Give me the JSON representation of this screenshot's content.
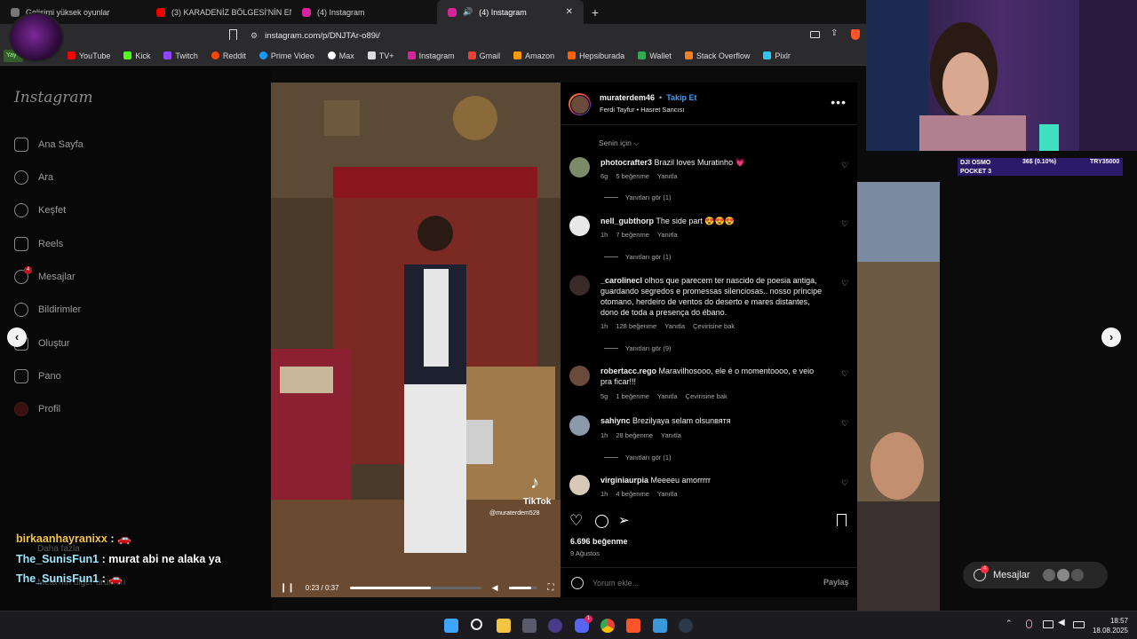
{
  "browser": {
    "tabs": [
      {
        "label": "Gelişimi yüksek oyunlar",
        "color": "#888888"
      },
      {
        "label": "(3) KARADENİZ BÖLGESİ'NİN EN DÜ",
        "color": "#ff0000"
      },
      {
        "label": "(4) Instagram",
        "color": "#d6249f"
      },
      {
        "label": "(4) Instagram",
        "color": "#d6249f"
      }
    ],
    "new_tab": "+",
    "url": "instagram.com/p/DNJTAr-o89i/",
    "bookmarks": [
      {
        "label": "YouTube",
        "color": "#ff0000"
      },
      {
        "label": "Kick",
        "color": "#53fc18"
      },
      {
        "label": "Twitch",
        "color": "#9146ff"
      },
      {
        "label": "Reddit",
        "color": "#ff4500"
      },
      {
        "label": "Prime Video",
        "color": "#1a98ff"
      },
      {
        "label": "Max",
        "color": "#ffffff"
      },
      {
        "label": "TV+",
        "color": "#dddddd"
      },
      {
        "label": "Instagram",
        "color": "#d6249f"
      },
      {
        "label": "Gmail",
        "color": "#ea4335"
      },
      {
        "label": "Amazon",
        "color": "#ff9900"
      },
      {
        "label": "Hepsiburada",
        "color": "#ff6000"
      },
      {
        "label": "Wallet",
        "color": "#34a853"
      },
      {
        "label": "Stack Overflow",
        "color": "#f48024"
      },
      {
        "label": "Pixlr",
        "color": "#2fc6f6"
      }
    ],
    "status_badge": "Yay"
  },
  "sidebar": {
    "logo": "Instagram",
    "items": [
      {
        "label": "Ana Sayfa",
        "icon": "home-icon"
      },
      {
        "label": "Ara",
        "icon": "search-icon"
      },
      {
        "label": "Keşfet",
        "icon": "compass-icon"
      },
      {
        "label": "Reels",
        "icon": "reels-icon"
      },
      {
        "label": "Mesajlar",
        "icon": "messenger-icon"
      },
      {
        "label": "Bildirimler",
        "icon": "heart-icon"
      },
      {
        "label": "Oluştur",
        "icon": "plus-icon"
      },
      {
        "label": "Pano",
        "icon": "dashboard-icon"
      },
      {
        "label": "Profil",
        "icon": "profile-icon"
      }
    ],
    "messages_badge": "4",
    "more": "Daha fazla",
    "meta": "Meta'nın diğer ürünleri"
  },
  "video": {
    "time": "0:23 / 0:37",
    "progress": 0.62,
    "volume": 0.8,
    "watermark": "TikTok",
    "watermark_user": "@muraterdem528"
  },
  "post": {
    "username": "muraterdem46",
    "follow": "Takip Et",
    "song": "Ferdi Tayfur • Hasret Sancısı",
    "sort": "Senin için",
    "comments": [
      {
        "user": "photocrafter3",
        "text": "Brazil loves Muratinho 💗",
        "age": "6g",
        "likes": "5 beğenme",
        "reply": "Yanıtla",
        "replies": "Yanıtları gör (1)"
      },
      {
        "user": "nell_gubthorp",
        "text": "The side part 😍😍😍",
        "age": "1h",
        "likes": "7 beğenme",
        "reply": "Yanıtla",
        "replies": "Yanıtları gör (1)"
      },
      {
        "user": "_carolinecl",
        "text": "olhos que parecem ter nascido de poesia antiga, guardando segredos e promessas silenciosas.. nosso príncipe otomano, herdeiro de ventos do deserto e mares distantes, dono de toda a presença do ébano.",
        "age": "1h",
        "likes": "128 beğenme",
        "reply": "Yanıtla",
        "translate": "Çevirisine bak",
        "replies": "Yanıtları gör (9)"
      },
      {
        "user": "robertacc.rego",
        "text": "Maravilhosooo, ele é o momentoooo, e veio pra ficar!!!",
        "age": "5g",
        "likes": "1 beğenme",
        "reply": "Yanıtla",
        "translate": "Çevirisine bak"
      },
      {
        "user": "sahiync",
        "text": "Brezilyaya selam olsunвятя",
        "age": "1h",
        "likes": "28 beğenme",
        "reply": "Yanıtla",
        "replies": "Yanıtları gör (1)"
      },
      {
        "user": "virginiaurpia",
        "text": "Meeeeu amorrrrr",
        "age": "1h",
        "likes": "4 beğenme",
        "reply": "Yanıtla"
      }
    ],
    "like_count": "6.696 beğenme",
    "date": "9 Ağustos",
    "comment_placeholder": "Yorum ekle...",
    "share": "Paylaş"
  },
  "stream": {
    "stock": {
      "name": "DJI OSMO POCKET 3",
      "change": "36$ (0.10%)",
      "price": "TRY35000"
    },
    "chat": [
      {
        "user": "birkaanhayranixx",
        "text": ": 🚗"
      },
      {
        "user": "The_SunisFun1",
        "text": ": murat abi ne alaka ya"
      },
      {
        "user": "The_SunisFun1",
        "text": ": 🚗"
      }
    ],
    "messages_label": "Mesajlar",
    "messages_badge": "4"
  },
  "taskbar": {
    "time": "18:57",
    "date": "18.08.2025",
    "badge": "1"
  }
}
